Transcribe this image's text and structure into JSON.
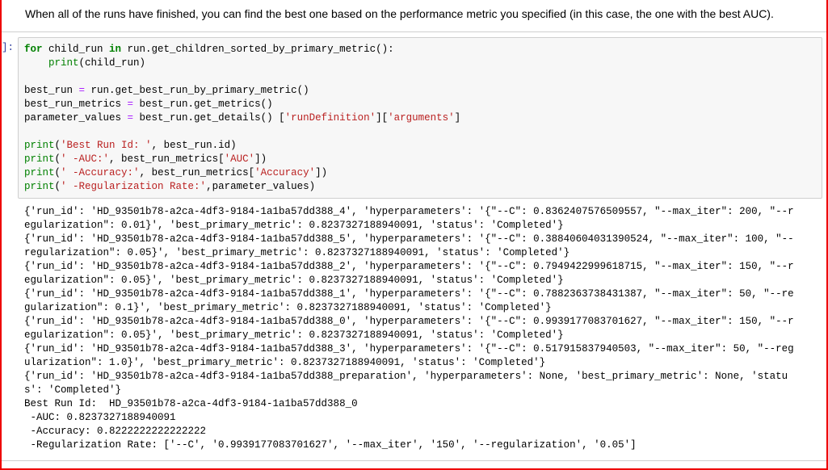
{
  "markdown": {
    "text": "When all of the runs have finished, you can find the best one based on the performance metric you specified (in this case, the one with the best AUC)."
  },
  "cell": {
    "prompt": "]:",
    "code_lines": [
      [
        {
          "k": "kw",
          "t": "for"
        },
        {
          "k": "",
          "t": " child_run "
        },
        {
          "k": "kw",
          "t": "in"
        },
        {
          "k": "",
          "t": " run.get_children_sorted_by_primary_metric():"
        }
      ],
      [
        {
          "k": "",
          "t": "    "
        },
        {
          "k": "bi",
          "t": "print"
        },
        {
          "k": "",
          "t": "(child_run)"
        }
      ],
      [],
      [
        {
          "k": "",
          "t": "best_run "
        },
        {
          "k": "op",
          "t": "="
        },
        {
          "k": "",
          "t": " run.get_best_run_by_primary_metric()"
        }
      ],
      [
        {
          "k": "",
          "t": "best_run_metrics "
        },
        {
          "k": "op",
          "t": "="
        },
        {
          "k": "",
          "t": " best_run.get_metrics()"
        }
      ],
      [
        {
          "k": "",
          "t": "parameter_values "
        },
        {
          "k": "op",
          "t": "="
        },
        {
          "k": "",
          "t": " best_run.get_details() ["
        },
        {
          "k": "st",
          "t": "'runDefinition'"
        },
        {
          "k": "",
          "t": "]["
        },
        {
          "k": "st",
          "t": "'arguments'"
        },
        {
          "k": "",
          "t": "]"
        }
      ],
      [],
      [
        {
          "k": "bi",
          "t": "print"
        },
        {
          "k": "",
          "t": "("
        },
        {
          "k": "st",
          "t": "'Best Run Id: '"
        },
        {
          "k": "",
          "t": ", best_run.id)"
        }
      ],
      [
        {
          "k": "bi",
          "t": "print"
        },
        {
          "k": "",
          "t": "("
        },
        {
          "k": "st",
          "t": "' -AUC:'"
        },
        {
          "k": "",
          "t": ", best_run_metrics["
        },
        {
          "k": "st",
          "t": "'AUC'"
        },
        {
          "k": "",
          "t": "])"
        }
      ],
      [
        {
          "k": "bi",
          "t": "print"
        },
        {
          "k": "",
          "t": "("
        },
        {
          "k": "st",
          "t": "' -Accuracy:'"
        },
        {
          "k": "",
          "t": ", best_run_metrics["
        },
        {
          "k": "st",
          "t": "'Accuracy'"
        },
        {
          "k": "",
          "t": "])"
        }
      ],
      [
        {
          "k": "bi",
          "t": "print"
        },
        {
          "k": "",
          "t": "("
        },
        {
          "k": "st",
          "t": "' -Regularization Rate:'"
        },
        {
          "k": "",
          "t": ",parameter_values)"
        }
      ]
    ],
    "output_lines": [
      "{'run_id': 'HD_93501b78-a2ca-4df3-9184-1a1ba57dd388_4', 'hyperparameters': '{\"--C\": 0.8362407576509557, \"--max_iter\": 200, \"--r",
      "egularization\": 0.01}', 'best_primary_metric': 0.8237327188940091, 'status': 'Completed'}",
      "{'run_id': 'HD_93501b78-a2ca-4df3-9184-1a1ba57dd388_5', 'hyperparameters': '{\"--C\": 0.38840604031390524, \"--max_iter\": 100, \"--",
      "regularization\": 0.05}', 'best_primary_metric': 0.8237327188940091, 'status': 'Completed'}",
      "{'run_id': 'HD_93501b78-a2ca-4df3-9184-1a1ba57dd388_2', 'hyperparameters': '{\"--C\": 0.7949422999618715, \"--max_iter\": 150, \"--r",
      "egularization\": 0.05}', 'best_primary_metric': 0.8237327188940091, 'status': 'Completed'}",
      "{'run_id': 'HD_93501b78-a2ca-4df3-9184-1a1ba57dd388_1', 'hyperparameters': '{\"--C\": 0.7882363738431387, \"--max_iter\": 50, \"--re",
      "gularization\": 0.1}', 'best_primary_metric': 0.8237327188940091, 'status': 'Completed'}",
      "{'run_id': 'HD_93501b78-a2ca-4df3-9184-1a1ba57dd388_0', 'hyperparameters': '{\"--C\": 0.9939177083701627, \"--max_iter\": 150, \"--r",
      "egularization\": 0.05}', 'best_primary_metric': 0.8237327188940091, 'status': 'Completed'}",
      "{'run_id': 'HD_93501b78-a2ca-4df3-9184-1a1ba57dd388_3', 'hyperparameters': '{\"--C\": 0.517915837940503, \"--max_iter\": 50, \"--reg",
      "ularization\": 1.0}', 'best_primary_metric': 0.8237327188940091, 'status': 'Completed'}",
      "{'run_id': 'HD_93501b78-a2ca-4df3-9184-1a1ba57dd388_preparation', 'hyperparameters': None, 'best_primary_metric': None, 'statu",
      "s': 'Completed'}",
      "Best Run Id:  HD_93501b78-a2ca-4df3-9184-1a1ba57dd388_0",
      " -AUC: 0.8237327188940091",
      " -Accuracy: 0.8222222222222222",
      " -Regularization Rate: ['--C', '0.9939177083701627', '--max_iter', '150', '--regularization', '0.05']"
    ]
  },
  "colors": {
    "selected_cell_border": "#ee0000",
    "keyword": "#008000",
    "string": "#ba2121",
    "operator": "#aa22ff",
    "prompt": "#303f9f",
    "input_background": "#f7f7f7"
  }
}
